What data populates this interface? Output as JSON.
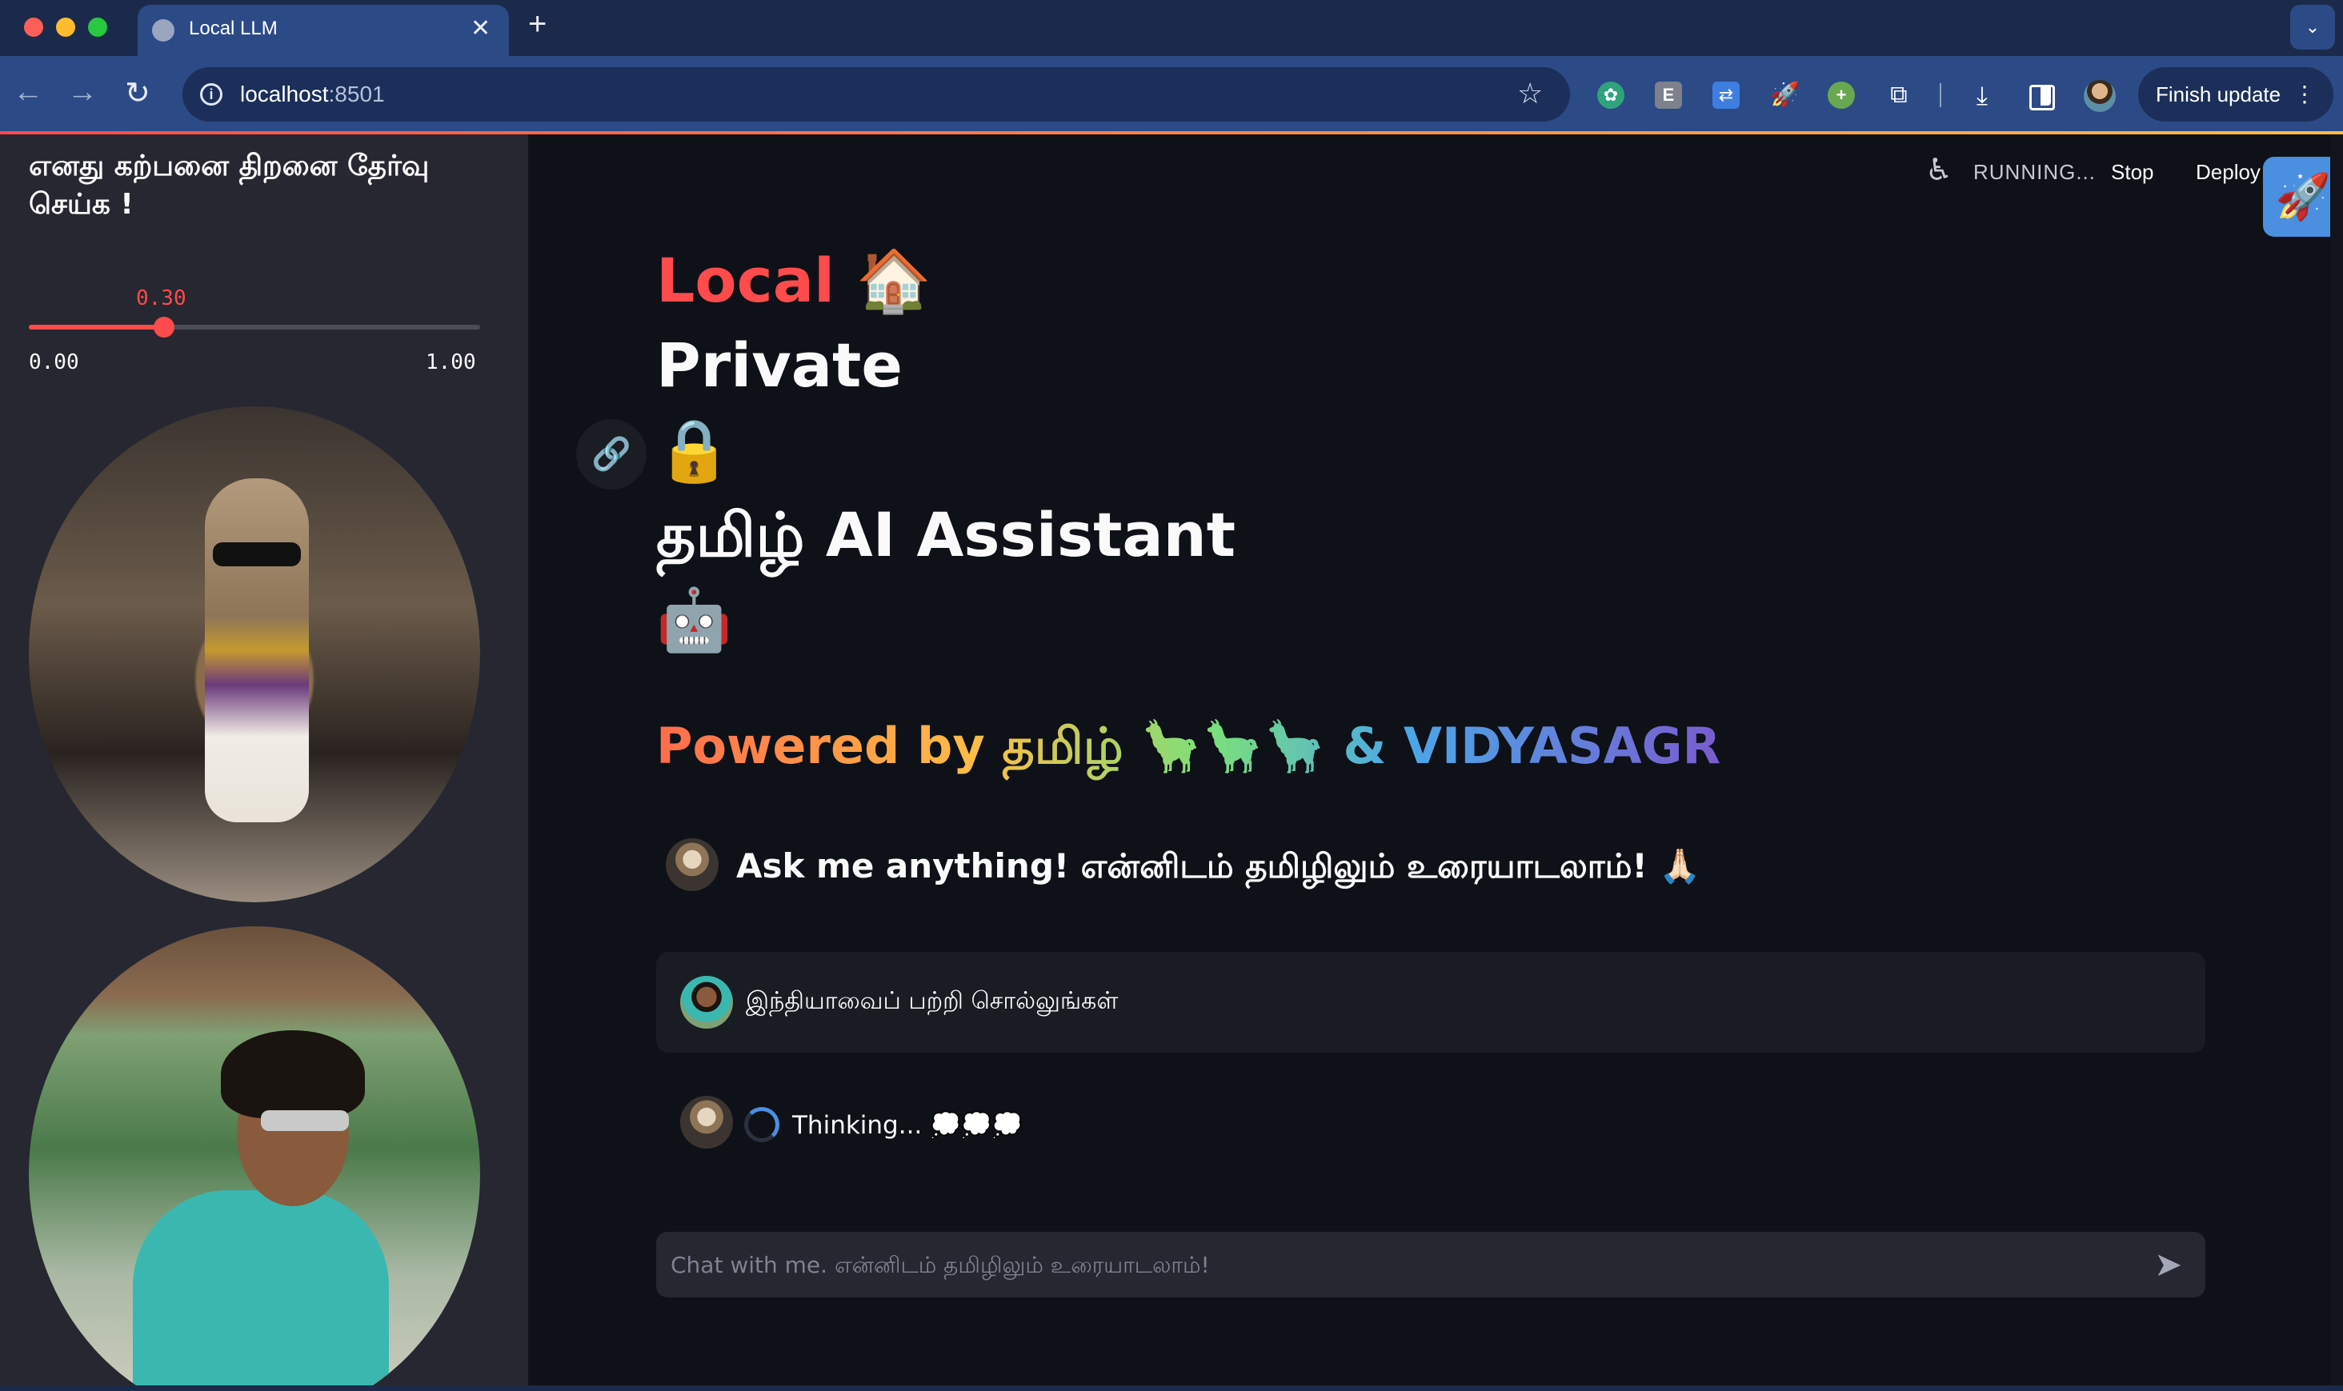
{
  "browser": {
    "tab_title": "Local LLM",
    "tab_close_label": "✕",
    "new_tab_label": "+",
    "url_host": "localhost",
    "url_port": ":8501",
    "finish_update_label": "Finish update",
    "extension_icons": [
      "openai-icon",
      "e-extension-icon",
      "translate-icon",
      "rocket-icon",
      "plus-extension-icon",
      "puzzle-icon",
      "download-icon",
      "sidepanel-icon"
    ]
  },
  "sidebar": {
    "heading": "எனது கற்பனை திறனை தேர்வு செய்க !",
    "slider": {
      "value": 0.3,
      "value_label": "0.30",
      "min_label": "0.00",
      "max_label": "1.00",
      "accent": "#ff4b4b"
    }
  },
  "header": {
    "status": "RUNNING...",
    "stop_label": "Stop",
    "deploy_label": "Deploy"
  },
  "main": {
    "title": {
      "local": "Local",
      "house_emoji": "🏠",
      "private": "Private",
      "lock_emoji": "🔒",
      "assistant": "தமிழ் AI Assistant",
      "robot_emoji": "🤖"
    },
    "powered_by": "Powered by தமிழ் 🦙🦙🦙 & VIDYASAGR",
    "messages": [
      {
        "role": "assistant",
        "text": "Ask me anything! என்னிடம் தமிழிலும் உரையாடலாம்! 🙏🏻"
      },
      {
        "role": "user",
        "text": "இந்தியாவைப் பற்றி சொல்லுங்கள்"
      },
      {
        "role": "assistant",
        "text": "Thinking... 💭💭💭"
      }
    ],
    "chat_input": {
      "placeholder": "Chat with me. என்னிடம் தமிழிலும் உரையாடலாம்!",
      "value": ""
    }
  },
  "colors": {
    "accent": "#ff4b4b",
    "sidebar_bg": "#262730",
    "main_bg": "#0e1117",
    "chrome": "#2c4a86"
  }
}
